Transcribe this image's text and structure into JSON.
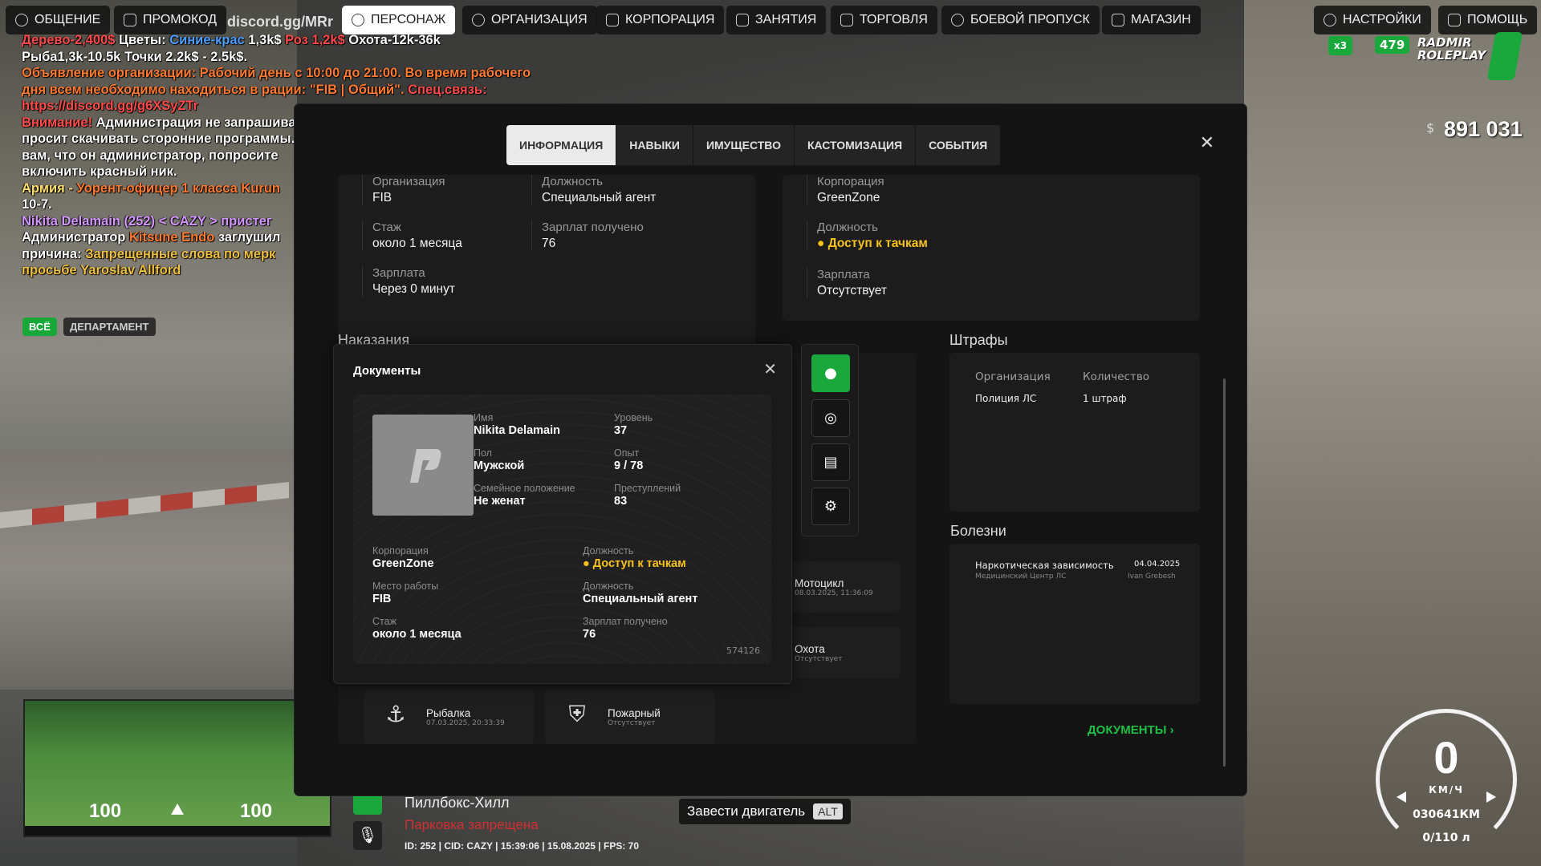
{
  "topnav": {
    "tabs": [
      {
        "label": "ОБЩЕНИЕ",
        "icon": "chat-icon"
      },
      {
        "label": "ПРОМОКОД",
        "icon": "user-tree-icon"
      },
      {
        "label": "ПЕРСОНАЖ",
        "icon": "person-icon",
        "active": true
      },
      {
        "label": "ОРГАНИЗАЦИЯ",
        "icon": "group-icon"
      },
      {
        "label": "КОРПОРАЦИЯ",
        "icon": "handshake-icon"
      },
      {
        "label": "ЗАНЯТИЯ",
        "icon": "list-icon"
      },
      {
        "label": "ТОРГОВЛЯ",
        "icon": "chart-icon"
      },
      {
        "label": "БОЕВОЙ ПРОПУСК",
        "icon": "gear-badge-icon"
      },
      {
        "label": "МАГАЗИН",
        "icon": "cart-icon"
      },
      {
        "label": "НАСТРОЙКИ",
        "icon": "gear-icon"
      },
      {
        "label": "ПОМОЩЬ",
        "icon": "help-icon"
      }
    ],
    "discord_text": "discord.gg/MRr"
  },
  "chat": {
    "lines": [
      [
        {
          "t": "Дерево-2,400$ ",
          "c": "c-red"
        },
        {
          "t": "Цветы: ",
          "c": "c-white"
        },
        {
          "t": "Синие-крас ",
          "c": "c-blue"
        },
        {
          "t": "1,3k$ ",
          "c": "c-white"
        },
        {
          "t": "Роз 1,2k$ ",
          "c": "c-red"
        },
        {
          "t": "Охота-12k-36k",
          "c": "c-white"
        }
      ],
      [
        {
          "t": "Рыба1,3k-10.5k Точки 2.2k$ - 2.5k$.",
          "c": "c-white"
        }
      ],
      [
        {
          "t": "Объявление организации: Рабочий день с 10:00 до 21:00. Во время рабочего",
          "c": "c-orange"
        }
      ],
      [
        {
          "t": "дня всем необходимо находиться в рации: \"FIB | Общий\". ",
          "c": "c-orange"
        },
        {
          "t": "Спец.связь:",
          "c": "c-red"
        }
      ],
      [
        {
          "t": "https://discord.gg/g6XSyZTr",
          "c": "c-red"
        }
      ],
      [
        {
          "t": "Внимание! ",
          "c": "c-red"
        },
        {
          "t": "Администрация не запрашивает пароли и не",
          "c": "c-white"
        }
      ],
      [
        {
          "t": "просит скачивать сторонние программы. Если",
          "c": "c-white"
        }
      ],
      [
        {
          "t": "вам, что он администратор, попросите",
          "c": "c-white"
        }
      ],
      [
        {
          "t": "включить красный ник.",
          "c": "c-white"
        }
      ],
      [
        {
          "t": "Армия - ",
          "c": "c-yellow"
        },
        {
          "t": "Уорент-офицер 1 класса Kurun",
          "c": "c-orange"
        }
      ],
      [
        {
          "t": "10-7.",
          "c": "c-white"
        }
      ],
      [
        {
          "t": "Nikita Delamain (252) < CAZY > пристег",
          "c": "c-pink"
        }
      ],
      [
        {
          "t": "Администратор ",
          "c": "c-white"
        },
        {
          "t": "Kitsune Endo ",
          "c": "c-orange"
        },
        {
          "t": "заглушил",
          "c": "c-white"
        }
      ],
      [
        {
          "t": "причина: ",
          "c": "c-white"
        },
        {
          "t": "Запрещенные слова по мерк",
          "c": "c-gold"
        }
      ],
      [
        {
          "t": "просьбе Yaroslav Allford",
          "c": "c-gold"
        }
      ]
    ],
    "filters": [
      "ВСЁ",
      "ДЕПАРТАМЕНТ"
    ]
  },
  "panel": {
    "tabs": [
      "ИНФОРМАЦИЯ",
      "НАВЫКИ",
      "ИМУЩЕСТВО",
      "КАСТОМИЗАЦИЯ",
      "СОБЫТИЯ"
    ],
    "org": {
      "org_label": "Организация",
      "org_value": "FIB",
      "pos_label": "Должность",
      "pos_value": "Специальный агент",
      "stage_label": "Стаж",
      "stage_value": "около 1 месяца",
      "paid_label": "Зарплат получено",
      "paid_value": "76",
      "salary_label": "Зарплата",
      "salary_value": "Через 0 минут"
    },
    "corp": {
      "corp_label": "Корпорация",
      "corp_value": "GreenZone",
      "pos_label": "Должность",
      "pos_value": "Доступ к тачкам",
      "salary_label": "Зарплата",
      "salary_value": "Отсутствует"
    },
    "punishments_title": "Наказания",
    "fines": {
      "title": "Штрафы",
      "col_org": "Организация",
      "col_count": "Количество",
      "row_org": "Полиция ЛС",
      "row_count": "1 штраф"
    },
    "diseases": {
      "title": "Болезни",
      "name": "Наркотическая зависимость",
      "date": "04.04.2025",
      "place": "Медицинский Центр ЛС",
      "doctor": "Ivan Grebesh"
    },
    "licenses": [
      {
        "title": "Мотоцикл",
        "sub": "08.03.2025, 11:36:09"
      },
      {
        "title": "Охота",
        "sub": "Отсутствует"
      },
      {
        "title": "Рыбалка",
        "sub": "07.03.2025, 20:33:39"
      },
      {
        "title": "Пожарный",
        "sub": "Отсутствует"
      }
    ],
    "documents_button": "ДОКУМЕНТЫ"
  },
  "docs": {
    "title": "Документы",
    "name_label": "Имя",
    "name_value": "Nikita Delamain",
    "level_label": "Уровень",
    "level_value": "37",
    "sex_label": "Пол",
    "sex_value": "Мужской",
    "exp_label": "Опыт",
    "exp_value": "9 / 78",
    "family_label": "Семейное положение",
    "family_value": "Не женат",
    "crimes_label": "Преступлений",
    "crimes_value": "83",
    "corp_label": "Корпорация",
    "corp_value": "GreenZone",
    "cpos_label": "Должность",
    "cpos_value": "Доступ к тачкам",
    "work_label": "Место работы",
    "work_value": "FIB",
    "wpos_label": "Должность",
    "wpos_value": "Специальный агент",
    "stage_label": "Стаж",
    "stage_value": "около 1 месяца",
    "paid_label": "Зарплат получено",
    "paid_value": "76",
    "number": "574126"
  },
  "hud": {
    "money_symbol": "$",
    "money": "891 031",
    "server_name": "RADMIR ROLEPLAY",
    "online": "479",
    "x_badge": "x3",
    "speed": "0",
    "speed_unit": "КМ/Ч",
    "odometer": "030641КМ",
    "fuel": "0/110 л",
    "location": "Пиллбокс-Хилл",
    "parking": "Парковка запрещена",
    "status_line": "ID: 252 | CID: CAZY | 15:39:06 | 15.08.2025 | FPS: 70",
    "engine_hint": "Завести двигатель",
    "engine_key": "ALT",
    "minimap_left": "100",
    "minimap_right": "100"
  },
  "colors": {
    "accent_green": "#1aa83c",
    "gold": "#f7c21c",
    "panel_bg": "#141414"
  }
}
